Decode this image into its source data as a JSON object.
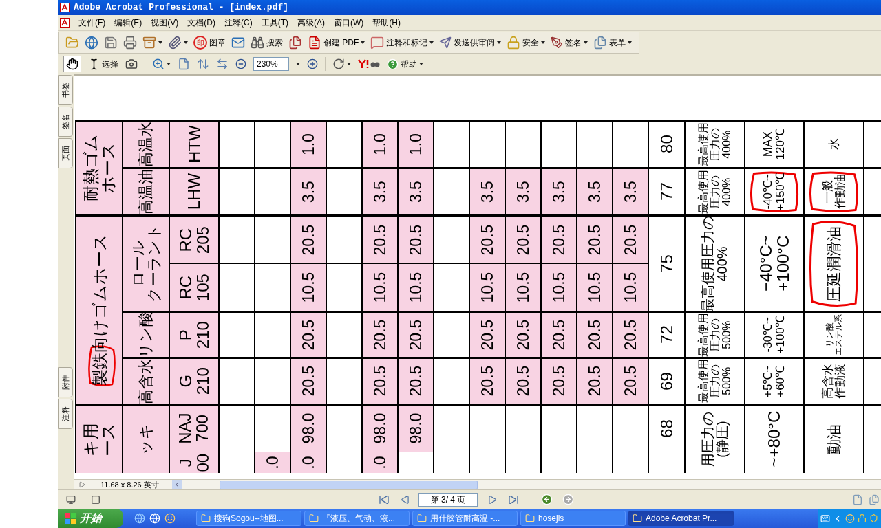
{
  "window": {
    "title": "Adobe Acrobat Professional - [index.pdf]"
  },
  "menu": [
    "文件(F)",
    "编辑(E)",
    "视图(V)",
    "文档(D)",
    "注释(C)",
    "工具(T)",
    "高级(A)",
    "窗口(W)",
    "帮助(H)"
  ],
  "toolbar_1": [
    {
      "dropdown": false
    },
    {
      "dropdown": false
    },
    {
      "dropdown": false
    },
    {
      "dropdown": false
    },
    {
      "dropdown": true
    },
    {
      "dropdown": true
    },
    {
      "dropdown": false,
      "glyph": "印",
      "label": "图章"
    },
    {
      "dropdown": false
    },
    {
      "dropdown": false,
      "label": "搜索"
    },
    {
      "dropdown": false
    },
    {
      "dropdown": true,
      "label": "创建 PDF"
    },
    {
      "dropdown": true,
      "label": "注释和标记"
    },
    {
      "dropdown": true,
      "label": "发送供审阅"
    },
    {
      "dropdown": true,
      "label": "安全"
    },
    {
      "dropdown": true,
      "label": "签名"
    },
    {
      "dropdown": true,
      "label": "表单"
    }
  ],
  "toolbar_2": {
    "hand_selected": true,
    "select_label": "选择",
    "zoom": {
      "value": "230%"
    },
    "help_label": "帮助"
  },
  "nav_tabs_top": [
    "书签",
    "签名",
    "页面"
  ],
  "nav_tabs_bottom": [
    "附件",
    "注释"
  ],
  "table": {
    "groups": [
      {
        "name": [
          "耐熱ゴム",
          "ホース"
        ],
        "one_line": false,
        "circled": false,
        "subgroups": [
          {
            "label": [
              "高温水"
            ],
            "number": "80",
            "pressure": [
              "最高使用",
              "圧力の",
              "400%"
            ],
            "temp": [
              "MAX",
              "120℃"
            ],
            "temp_circled": false,
            "fluid": [
              "水"
            ],
            "fluid_circled": false,
            "rows": [
              {
                "code": [
                  "HTW"
                ],
                "cells": [
                  {
                    "highlighted": false
                  },
                  {
                    "highlighted": false
                  },
                  {
                    "text": "1.0",
                    "highlighted": true
                  },
                  {
                    "highlighted": false
                  },
                  {
                    "text": "1.0",
                    "highlighted": true
                  },
                  {
                    "text": "1.0",
                    "highlighted": true
                  },
                  {
                    "highlighted": false
                  },
                  {
                    "highlighted": false
                  },
                  {
                    "highlighted": false
                  },
                  {
                    "highlighted": false
                  },
                  {
                    "highlighted": false
                  },
                  {
                    "highlighted": false
                  }
                ]
              }
            ]
          },
          {
            "label": [
              "高温油"
            ],
            "number": "77",
            "pressure": [
              "最高使用",
              "圧力の",
              "400%"
            ],
            "temp": [
              "-40℃~",
              "+150℃"
            ],
            "temp_circled": true,
            "fluid": [
              "一般",
              "作動油"
            ],
            "fluid_circled": true,
            "rows": [
              {
                "code": [
                  "LHW"
                ],
                "cells": [
                  {
                    "highlighted": false
                  },
                  {
                    "highlighted": false
                  },
                  {
                    "text": "3.5",
                    "highlighted": true
                  },
                  {
                    "highlighted": false
                  },
                  {
                    "text": "3.5",
                    "highlighted": true
                  },
                  {
                    "text": "3.5",
                    "highlighted": true
                  },
                  {
                    "highlighted": false
                  },
                  {
                    "text": "3.5",
                    "highlighted": true
                  },
                  {
                    "text": "3.5",
                    "highlighted": true
                  },
                  {
                    "text": "3.5",
                    "highlighted": true
                  },
                  {
                    "text": "3.5",
                    "highlighted": true
                  },
                  {
                    "text": "3.5",
                    "highlighted": true
                  }
                ]
              }
            ]
          }
        ]
      },
      {
        "name": [
          "製鉄",
          "向けゴムホース"
        ],
        "one_line": true,
        "circled": true,
        "subgroups": [
          {
            "label": [
              "ロール",
              "クーラント"
            ],
            "number": "75",
            "pressure": [
              "最高使用圧力の",
              "400%"
            ],
            "temp": [
              "−40°C~",
              "+100°C"
            ],
            "temp_circled": false,
            "fluid": [
              "圧延潤滑油"
            ],
            "fluid_circled": true,
            "rows": [
              {
                "code": [
                  "RC",
                  "205"
                ],
                "cells": [
                  {
                    "highlighted": false
                  },
                  {
                    "highlighted": false
                  },
                  {
                    "text": "20.5",
                    "highlighted": true
                  },
                  {
                    "highlighted": false
                  },
                  {
                    "text": "20.5",
                    "highlighted": true
                  },
                  {
                    "text": "20.5",
                    "highlighted": true
                  },
                  {
                    "highlighted": false
                  },
                  {
                    "text": "20.5",
                    "highlighted": true
                  },
                  {
                    "text": "20.5",
                    "highlighted": true
                  },
                  {
                    "text": "20.5",
                    "highlighted": true
                  },
                  {
                    "text": "20.5",
                    "highlighted": true
                  },
                  {
                    "text": "20.5",
                    "highlighted": true
                  }
                ]
              },
              {
                "code": [
                  "RC",
                  "105"
                ],
                "cells": [
                  {
                    "highlighted": false
                  },
                  {
                    "highlighted": false
                  },
                  {
                    "text": "10.5",
                    "highlighted": true
                  },
                  {
                    "highlighted": false
                  },
                  {
                    "text": "10.5",
                    "highlighted": true
                  },
                  {
                    "text": "10.5",
                    "highlighted": true
                  },
                  {
                    "highlighted": false
                  },
                  {
                    "text": "10.5",
                    "highlighted": true
                  },
                  {
                    "text": "10.5",
                    "highlighted": true
                  },
                  {
                    "text": "10.5",
                    "highlighted": true
                  },
                  {
                    "text": "10.5",
                    "highlighted": true
                  },
                  {
                    "text": "10.5",
                    "highlighted": true
                  }
                ]
              }
            ]
          },
          {
            "label": [
              "リン酸"
            ],
            "number": "72",
            "pressure": [
              "最高使用",
              "圧力の",
              "500%"
            ],
            "temp": [
              "-30℃~",
              "+100℃"
            ],
            "temp_circled": false,
            "fluid": [
              "リン酸",
              "エステル系"
            ],
            "fluid_circled": false,
            "rows": [
              {
                "code": [
                  "P",
                  "210"
                ],
                "cells": [
                  {
                    "highlighted": false
                  },
                  {
                    "highlighted": false
                  },
                  {
                    "text": "20.5",
                    "highlighted": true
                  },
                  {
                    "highlighted": false
                  },
                  {
                    "text": "20.5",
                    "highlighted": true
                  },
                  {
                    "text": "20.5",
                    "highlighted": true
                  },
                  {
                    "highlighted": false
                  },
                  {
                    "text": "20.5",
                    "highlighted": true
                  },
                  {
                    "text": "20.5",
                    "highlighted": true
                  },
                  {
                    "text": "20.5",
                    "highlighted": true
                  },
                  {
                    "text": "20.5",
                    "highlighted": true
                  },
                  {
                    "text": "20.5",
                    "highlighted": true
                  }
                ]
              }
            ]
          },
          {
            "label": [
              "高含水"
            ],
            "number": "69",
            "pressure": [
              "最高使用",
              "圧力の",
              "500%"
            ],
            "temp": [
              "+5℃~",
              "+60℃"
            ],
            "temp_circled": false,
            "fluid": [
              "高含水",
              "作動液"
            ],
            "fluid_circled": false,
            "rows": [
              {
                "code": [
                  "G",
                  "210"
                ],
                "cells": [
                  {
                    "highlighted": false
                  },
                  {
                    "highlighted": false
                  },
                  {
                    "text": "20.5",
                    "highlighted": true
                  },
                  {
                    "highlighted": false
                  },
                  {
                    "text": "20.5",
                    "highlighted": true
                  },
                  {
                    "text": "20.5",
                    "highlighted": true
                  },
                  {
                    "highlighted": false
                  },
                  {
                    "text": "20.5",
                    "highlighted": true
                  },
                  {
                    "text": "20.5",
                    "highlighted": true
                  },
                  {
                    "text": "20.5",
                    "highlighted": true
                  },
                  {
                    "text": "20.5",
                    "highlighted": true
                  },
                  {
                    "text": "20.5",
                    "highlighted": true
                  }
                ]
              }
            ]
          }
        ]
      },
      {
        "name": [
          "キ用",
          "ース"
        ],
        "one_line": false,
        "circled": false,
        "subgroups": [
          {
            "label": [
              "ッキ"
            ],
            "pressure": [
              "用圧力の",
              "(静圧)"
            ],
            "temp": [
              "~+80°C"
            ],
            "temp_circled": false,
            "fluid": [
              "動油"
            ],
            "fluid_circled": false,
            "rows": [
              {
                "code": [
                  "NAJ",
                  "700"
                ],
                "number": "68",
                "cells": [
                  {
                    "highlighted": false
                  },
                  {
                    "highlighted": false
                  },
                  {
                    "text": "98.0",
                    "highlighted": true
                  },
                  {
                    "highlighted": false
                  },
                  {
                    "text": "98.0",
                    "highlighted": true
                  },
                  {
                    "text": "98.0",
                    "highlighted": true
                  },
                  {
                    "highlighted": false
                  },
                  {
                    "highlighted": false
                  },
                  {
                    "highlighted": false
                  },
                  {
                    "highlighted": false
                  },
                  {
                    "highlighted": false
                  },
                  {
                    "highlighted": false
                  }
                ]
              },
              {
                "code": [
                  "J",
                  "00"
                ],
                "cells": [
                  {
                    "highlighted": false
                  },
                  {
                    "text": ".0",
                    "highlighted": true
                  },
                  {
                    "text": ".0",
                    "highlighted": true
                  },
                  {
                    "highlighted": false
                  },
                  {
                    "text": ".0",
                    "highlighted": true
                  },
                  {
                    "highlighted": false
                  },
                  {
                    "highlighted": false
                  },
                  {
                    "highlighted": false
                  },
                  {
                    "highlighted": false
                  },
                  {
                    "highlighted": false
                  },
                  {
                    "highlighted": false
                  },
                  {
                    "highlighted": false
                  }
                ]
              }
            ]
          }
        ]
      }
    ]
  },
  "page_size": "11.68 x 8.26 英寸",
  "page_field": "第 3/ 4 页",
  "taskbar": {
    "start": "开始",
    "tasks": [
      {
        "label": "搜狗Sogou--地图...",
        "selected": false
      },
      {
        "label": "『液压、气动、液...",
        "selected": false
      },
      {
        "label": "用什胶管耐高温 -...",
        "selected": false
      },
      {
        "label": "hosejis",
        "selected": false
      },
      {
        "label": "Adobe Acrobat Pr...",
        "selected": true
      }
    ]
  }
}
